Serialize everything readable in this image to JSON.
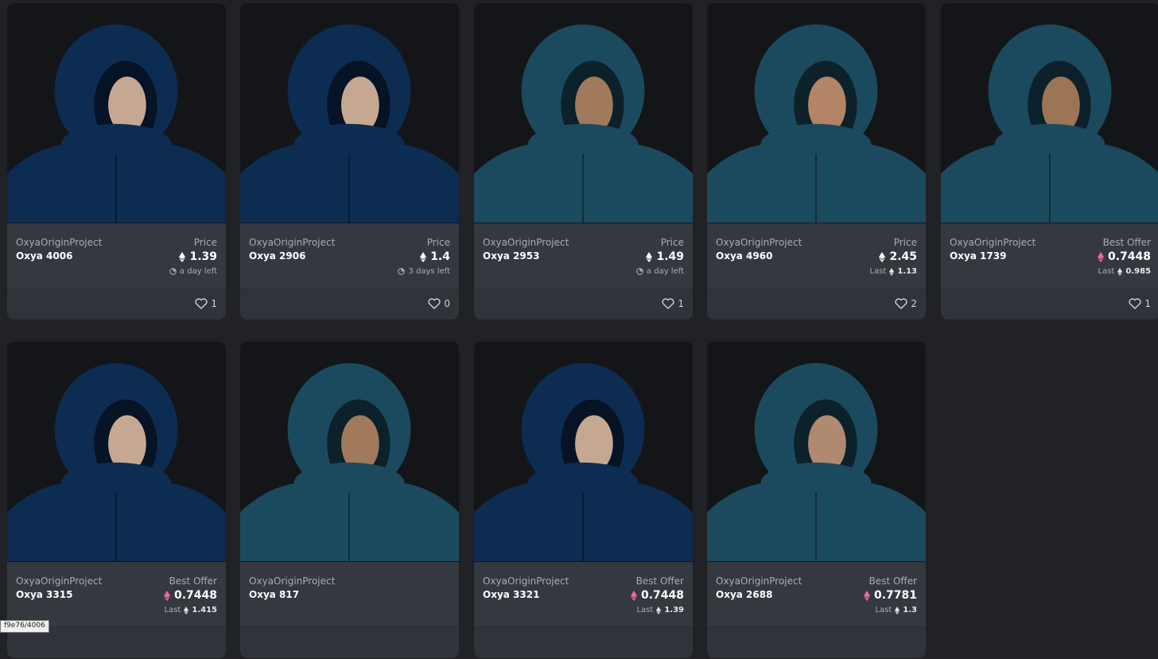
{
  "cards": [
    {
      "collection": "OxyaOriginProject",
      "name": "Oxya 4006",
      "price_label": "Price",
      "price": "1.39",
      "currency": "eth",
      "sub_type": "time",
      "sub_text": "a day left",
      "likes": "1",
      "palette": {
        "coat": "#0d2c52",
        "face": "#c6a892"
      }
    },
    {
      "collection": "OxyaOriginProject",
      "name": "Oxya 2906",
      "price_label": "Price",
      "price": "1.4",
      "currency": "eth",
      "sub_type": "time",
      "sub_text": "3 days left",
      "likes": "0",
      "palette": {
        "coat": "#0d2c52",
        "face": "#c6a892"
      }
    },
    {
      "collection": "OxyaOriginProject",
      "name": "Oxya 2953",
      "price_label": "Price",
      "price": "1.49",
      "currency": "eth",
      "sub_type": "time",
      "sub_text": "a day left",
      "likes": "1",
      "palette": {
        "coat": "#1b4a5e",
        "face": "#a07a5a"
      }
    },
    {
      "collection": "OxyaOriginProject",
      "name": "Oxya 4960",
      "price_label": "Price",
      "price": "2.45",
      "currency": "eth",
      "sub_type": "last",
      "sub_label": "Last",
      "sub_value": "1.13",
      "likes": "2",
      "palette": {
        "coat": "#1b4a5e",
        "face": "#b48466"
      }
    },
    {
      "collection": "OxyaOriginProject",
      "name": "Oxya 1739",
      "price_label": "Best Offer",
      "price": "0.7448",
      "currency": "weth",
      "sub_type": "last",
      "sub_label": "Last",
      "sub_value": "0.985",
      "likes": "1",
      "palette": {
        "coat": "#1b4a5e",
        "face": "#9c7456"
      }
    },
    {
      "collection": "OxyaOriginProject",
      "name": "Oxya 3315",
      "price_label": "Best Offer",
      "price": "0.7448",
      "currency": "weth",
      "sub_type": "last",
      "sub_label": "Last",
      "sub_value": "1.415",
      "likes": "",
      "palette": {
        "coat": "#0d2c52",
        "face": "#c6a892"
      }
    },
    {
      "collection": "OxyaOriginProject",
      "name": "Oxya 817",
      "price_label": "",
      "price": "",
      "currency": "",
      "sub_type": "none",
      "likes": "",
      "palette": {
        "coat": "#1b4a5e",
        "face": "#a07a5a"
      }
    },
    {
      "collection": "OxyaOriginProject",
      "name": "Oxya 3321",
      "price_label": "Best Offer",
      "price": "0.7448",
      "currency": "weth",
      "sub_type": "last",
      "sub_label": "Last",
      "sub_value": "1.39",
      "likes": "",
      "palette": {
        "coat": "#0d2c52",
        "face": "#c6a892"
      }
    },
    {
      "collection": "OxyaOriginProject",
      "name": "Oxya 2688",
      "price_label": "Best Offer",
      "price": "0.7781",
      "currency": "weth",
      "sub_type": "last",
      "sub_label": "Last",
      "sub_value": "1.3",
      "likes": "",
      "palette": {
        "coat": "#1b4a5e",
        "face": "#b08a70"
      }
    }
  ],
  "colors": {
    "eth": "#ffffff",
    "weth": "#ec6a9a",
    "background": "#202225",
    "card": "#303339"
  },
  "tooltip": {
    "text": "f9e76/4006"
  }
}
